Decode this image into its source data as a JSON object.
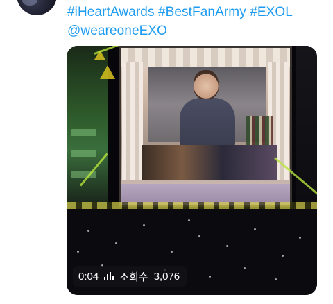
{
  "tweet": {
    "line1": [
      "#iHeartAwards",
      "#BestFanArmy",
      "#EXOL"
    ],
    "line2": "@weareoneEXO"
  },
  "media": {
    "duration": "0:04",
    "view_icon": "bar-chart-icon",
    "views_label": "조회수",
    "views_count": "3,076"
  },
  "colors": {
    "link": "#1d9bf0",
    "background": "#ffffff",
    "overlay": "rgba(20,20,24,0.72)"
  }
}
